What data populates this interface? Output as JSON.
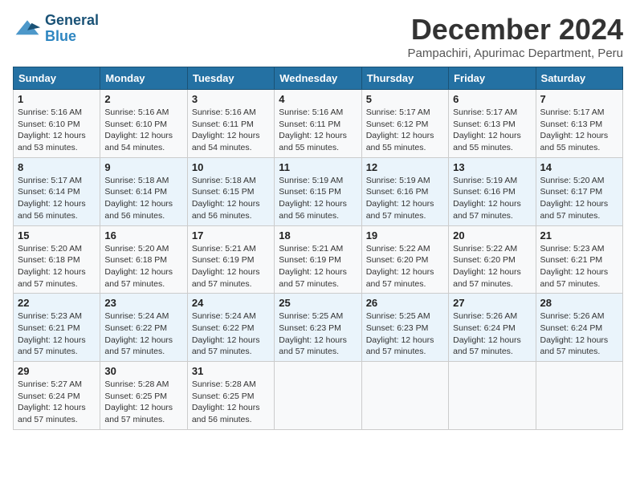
{
  "header": {
    "logo_line1": "General",
    "logo_line2": "Blue",
    "month": "December 2024",
    "location": "Pampachiri, Apurimac Department, Peru"
  },
  "weekdays": [
    "Sunday",
    "Monday",
    "Tuesday",
    "Wednesday",
    "Thursday",
    "Friday",
    "Saturday"
  ],
  "weeks": [
    [
      {
        "day": "1",
        "sunrise": "5:16 AM",
        "sunset": "6:10 PM",
        "daylight": "12 hours and 53 minutes."
      },
      {
        "day": "2",
        "sunrise": "5:16 AM",
        "sunset": "6:10 PM",
        "daylight": "12 hours and 54 minutes."
      },
      {
        "day": "3",
        "sunrise": "5:16 AM",
        "sunset": "6:11 PM",
        "daylight": "12 hours and 54 minutes."
      },
      {
        "day": "4",
        "sunrise": "5:16 AM",
        "sunset": "6:11 PM",
        "daylight": "12 hours and 55 minutes."
      },
      {
        "day": "5",
        "sunrise": "5:17 AM",
        "sunset": "6:12 PM",
        "daylight": "12 hours and 55 minutes."
      },
      {
        "day": "6",
        "sunrise": "5:17 AM",
        "sunset": "6:13 PM",
        "daylight": "12 hours and 55 minutes."
      },
      {
        "day": "7",
        "sunrise": "5:17 AM",
        "sunset": "6:13 PM",
        "daylight": "12 hours and 55 minutes."
      }
    ],
    [
      {
        "day": "8",
        "sunrise": "5:17 AM",
        "sunset": "6:14 PM",
        "daylight": "12 hours and 56 minutes."
      },
      {
        "day": "9",
        "sunrise": "5:18 AM",
        "sunset": "6:14 PM",
        "daylight": "12 hours and 56 minutes."
      },
      {
        "day": "10",
        "sunrise": "5:18 AM",
        "sunset": "6:15 PM",
        "daylight": "12 hours and 56 minutes."
      },
      {
        "day": "11",
        "sunrise": "5:19 AM",
        "sunset": "6:15 PM",
        "daylight": "12 hours and 56 minutes."
      },
      {
        "day": "12",
        "sunrise": "5:19 AM",
        "sunset": "6:16 PM",
        "daylight": "12 hours and 57 minutes."
      },
      {
        "day": "13",
        "sunrise": "5:19 AM",
        "sunset": "6:16 PM",
        "daylight": "12 hours and 57 minutes."
      },
      {
        "day": "14",
        "sunrise": "5:20 AM",
        "sunset": "6:17 PM",
        "daylight": "12 hours and 57 minutes."
      }
    ],
    [
      {
        "day": "15",
        "sunrise": "5:20 AM",
        "sunset": "6:18 PM",
        "daylight": "12 hours and 57 minutes."
      },
      {
        "day": "16",
        "sunrise": "5:20 AM",
        "sunset": "6:18 PM",
        "daylight": "12 hours and 57 minutes."
      },
      {
        "day": "17",
        "sunrise": "5:21 AM",
        "sunset": "6:19 PM",
        "daylight": "12 hours and 57 minutes."
      },
      {
        "day": "18",
        "sunrise": "5:21 AM",
        "sunset": "6:19 PM",
        "daylight": "12 hours and 57 minutes."
      },
      {
        "day": "19",
        "sunrise": "5:22 AM",
        "sunset": "6:20 PM",
        "daylight": "12 hours and 57 minutes."
      },
      {
        "day": "20",
        "sunrise": "5:22 AM",
        "sunset": "6:20 PM",
        "daylight": "12 hours and 57 minutes."
      },
      {
        "day": "21",
        "sunrise": "5:23 AM",
        "sunset": "6:21 PM",
        "daylight": "12 hours and 57 minutes."
      }
    ],
    [
      {
        "day": "22",
        "sunrise": "5:23 AM",
        "sunset": "6:21 PM",
        "daylight": "12 hours and 57 minutes."
      },
      {
        "day": "23",
        "sunrise": "5:24 AM",
        "sunset": "6:22 PM",
        "daylight": "12 hours and 57 minutes."
      },
      {
        "day": "24",
        "sunrise": "5:24 AM",
        "sunset": "6:22 PM",
        "daylight": "12 hours and 57 minutes."
      },
      {
        "day": "25",
        "sunrise": "5:25 AM",
        "sunset": "6:23 PM",
        "daylight": "12 hours and 57 minutes."
      },
      {
        "day": "26",
        "sunrise": "5:25 AM",
        "sunset": "6:23 PM",
        "daylight": "12 hours and 57 minutes."
      },
      {
        "day": "27",
        "sunrise": "5:26 AM",
        "sunset": "6:24 PM",
        "daylight": "12 hours and 57 minutes."
      },
      {
        "day": "28",
        "sunrise": "5:26 AM",
        "sunset": "6:24 PM",
        "daylight": "12 hours and 57 minutes."
      }
    ],
    [
      {
        "day": "29",
        "sunrise": "5:27 AM",
        "sunset": "6:24 PM",
        "daylight": "12 hours and 57 minutes."
      },
      {
        "day": "30",
        "sunrise": "5:28 AM",
        "sunset": "6:25 PM",
        "daylight": "12 hours and 57 minutes."
      },
      {
        "day": "31",
        "sunrise": "5:28 AM",
        "sunset": "6:25 PM",
        "daylight": "12 hours and 56 minutes."
      },
      null,
      null,
      null,
      null
    ]
  ]
}
